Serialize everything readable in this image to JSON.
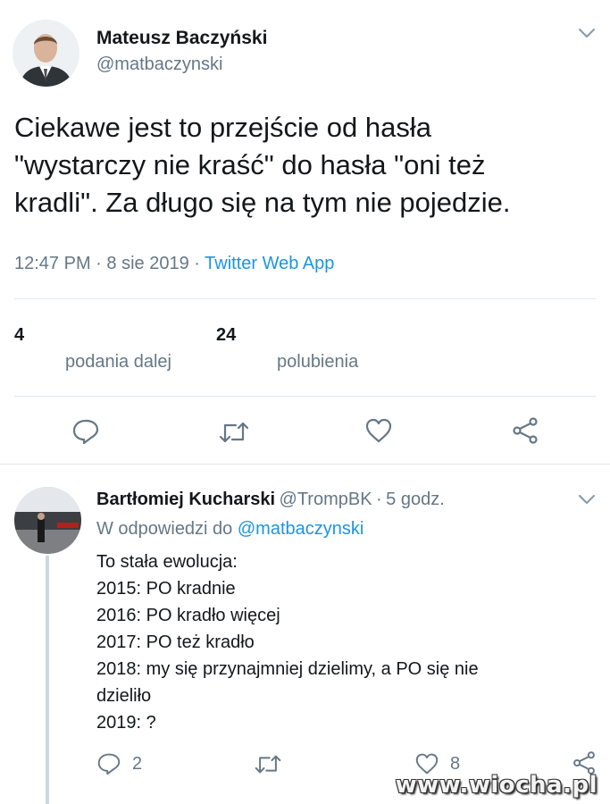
{
  "main_tweet": {
    "author_name": "Mateusz Baczyński",
    "author_handle": "@matbaczynski",
    "text_line1": "Ciekawe jest to przejście od hasła",
    "text_line2": "\"wystarczy nie kraść\" do hasła \"oni też",
    "text_line3": "kradli\". Za długo się na tym nie pojedzie.",
    "time": "12:47 PM",
    "date": "8 sie 2019",
    "source": "Twitter Web App",
    "retweets_count": "4",
    "retweets_label": "podania dalej",
    "likes_count": "24",
    "likes_label": "polubienia"
  },
  "reply": {
    "author_name": "Bartłomiej Kucharski",
    "author_handle": "@TrompBK",
    "age": "5 godz.",
    "in_reply_prefix": "W odpowiedzi do",
    "in_reply_handle": "@matbaczynski",
    "lines": [
      "To stała ewolucja:",
      "2015: PO kradnie",
      "2016: PO kradło więcej",
      "2017: PO też kradło",
      "2018: my się przynajmniej dzielimy, a PO się nie",
      "dzieliło",
      "2019: ?"
    ],
    "reply_count": "2",
    "like_count": "8"
  },
  "watermark": "www.wiocha.pl",
  "separator_dot": "·",
  "colors": {
    "link": "#1b95e0",
    "secondary": "#657786",
    "divider": "#e1e8ed"
  }
}
